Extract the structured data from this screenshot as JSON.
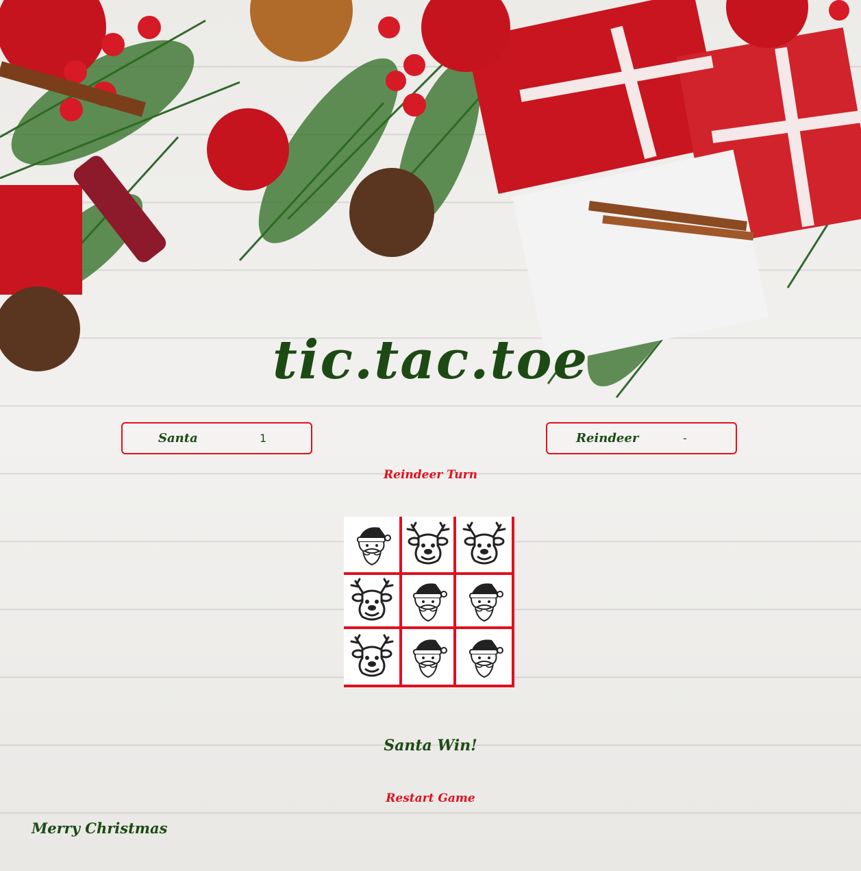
{
  "title": "tic.tac.toe",
  "players": [
    {
      "name": "Santa",
      "score": "1"
    },
    {
      "name": "Reindeer",
      "score": "-"
    }
  ],
  "turn_text": "Reindeer Turn",
  "board": [
    [
      "santa-icon",
      "reindeer-icon",
      "reindeer-icon"
    ],
    [
      "reindeer-icon",
      "santa-icon",
      "santa-icon"
    ],
    [
      "reindeer-icon",
      "santa-icon",
      "santa-icon"
    ]
  ],
  "result_text": "Santa Win!",
  "restart_label": "Restart Game",
  "footer": "Merry Christmas",
  "colors": {
    "accent": "#e0101e",
    "green": "#1d4a14"
  }
}
